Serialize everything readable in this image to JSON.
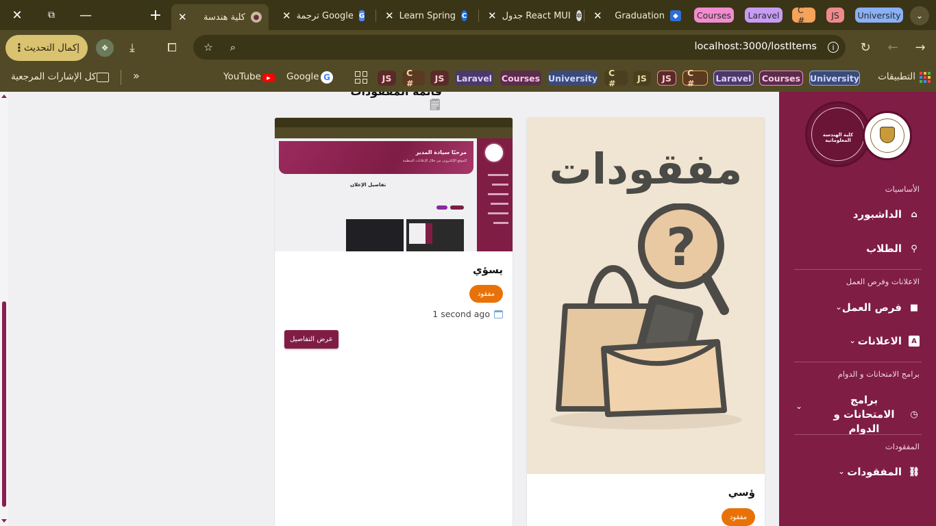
{
  "browser": {
    "tabs": [
      {
        "title": "كلية هندسة",
        "active": true
      },
      {
        "title": "ترجمة Google"
      },
      {
        "title": "Learn Spring"
      },
      {
        "title": "جدول React MUI"
      },
      {
        "title": "Graduation"
      }
    ],
    "tab_groups": [
      "Courses",
      "Laravel",
      "C #",
      "JS",
      "University"
    ],
    "url": "localhost:3000/lostItems",
    "update_label": "إكمال التحديث",
    "bookmarks": {
      "apps_label": "التطبيقات",
      "chips": [
        "University",
        "Courses",
        "Laravel",
        "C #",
        "JS",
        "JS",
        "C #",
        "University",
        "Courses",
        "Laravel",
        "JS",
        "C #",
        "JS"
      ],
      "google": "Google",
      "youtube": "YouTube",
      "all_bookmarks": "كل الإشارات المرجعية"
    }
  },
  "page": {
    "title": "قائمة المفقودات",
    "cards": [
      {
        "image_text": "مفقودات",
        "title": "ؤسي",
        "status": "مفقود"
      },
      {
        "title": "يسؤي",
        "status": "مفقود",
        "time": "1 second ago",
        "details_label": "عرض التفاصيل",
        "thumb_banner_title": "مرحبًا سيادة المدير",
        "thumb_banner_sub": "الموقع الإلكتروني من خلال الإعلانات المنظمة",
        "thumb_heading": "تفاصيل الإعلان"
      }
    ]
  },
  "sidebar": {
    "logo_text": "كلية الهندسة المعلوماتية",
    "sections": {
      "basics": "الأساسيات",
      "ads": "الاعلانات وفرص العمل",
      "exams": "برامج الامتحانات و الدوام",
      "lost": "المفقودات"
    },
    "items": {
      "dashboard": "الداشبورد",
      "students": "الطلاب",
      "jobs": "فرص العمل",
      "ads": "الاعلانات",
      "exams": "برامج الامتحانات و الدوام",
      "lost": "المفقودات"
    }
  },
  "colors": {
    "brand": "#7f1d45",
    "chip": "#e87207",
    "browser_frame": "#524a26"
  }
}
